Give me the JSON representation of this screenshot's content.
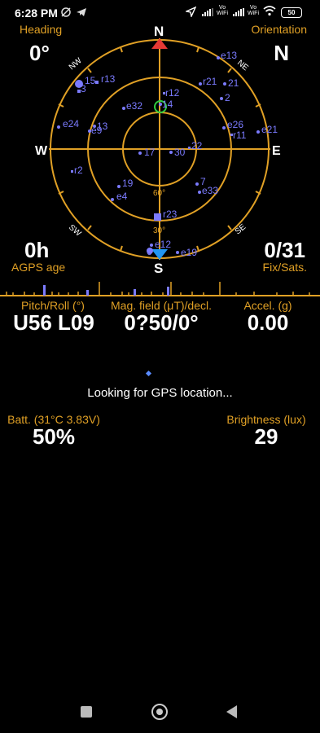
{
  "status_bar": {
    "time": "6:28 PM",
    "volte_1": "Vo\nWiFi",
    "volte_2": "Vo\nWiFi",
    "battery": "50"
  },
  "heading": {
    "label": "Heading",
    "value": "0°"
  },
  "orientation": {
    "label": "Orientation",
    "value": "N"
  },
  "agps": {
    "value": "0h",
    "label": "AGPS age"
  },
  "fix": {
    "value": "0/31",
    "label": "Fix/Sats."
  },
  "compass": {
    "north": "N",
    "south": "S",
    "east": "E",
    "west": "W",
    "ne": "NE",
    "nw": "NW",
    "se": "SE",
    "sw": "SW",
    "ring_60": "60°",
    "ring_30": "30°"
  },
  "satellites": [
    "e13",
    "15",
    "r13",
    "r21",
    "21",
    "3",
    "r12",
    "e32",
    "14",
    "2",
    "e24",
    "13",
    "e26",
    "e9",
    "r11",
    "e21",
    "17",
    "30",
    "22",
    "r2",
    "7",
    "19",
    "e33",
    "e4",
    "r23",
    "e12",
    "6",
    "e19"
  ],
  "sensors": {
    "pitch_label": "Pitch/Roll (°)",
    "pitch_value": "U56 L09",
    "mag_label": "Mag. field (μT)/decl.",
    "mag_value": "0?50/0°",
    "accel_label": "Accel. (g)",
    "accel_value": "0.00"
  },
  "status_message": "Looking for GPS location...",
  "battery_stat": {
    "label": "Batt. (31°C 3.83V)",
    "value": "50%"
  },
  "brightness": {
    "label": "Brightness (lux)",
    "value": "29"
  },
  "colors": {
    "accent": "#e0a025",
    "sat": "#7b7bff",
    "north": "#e53935",
    "south": "#2196f3",
    "fix_ring": "#2ecc40"
  }
}
